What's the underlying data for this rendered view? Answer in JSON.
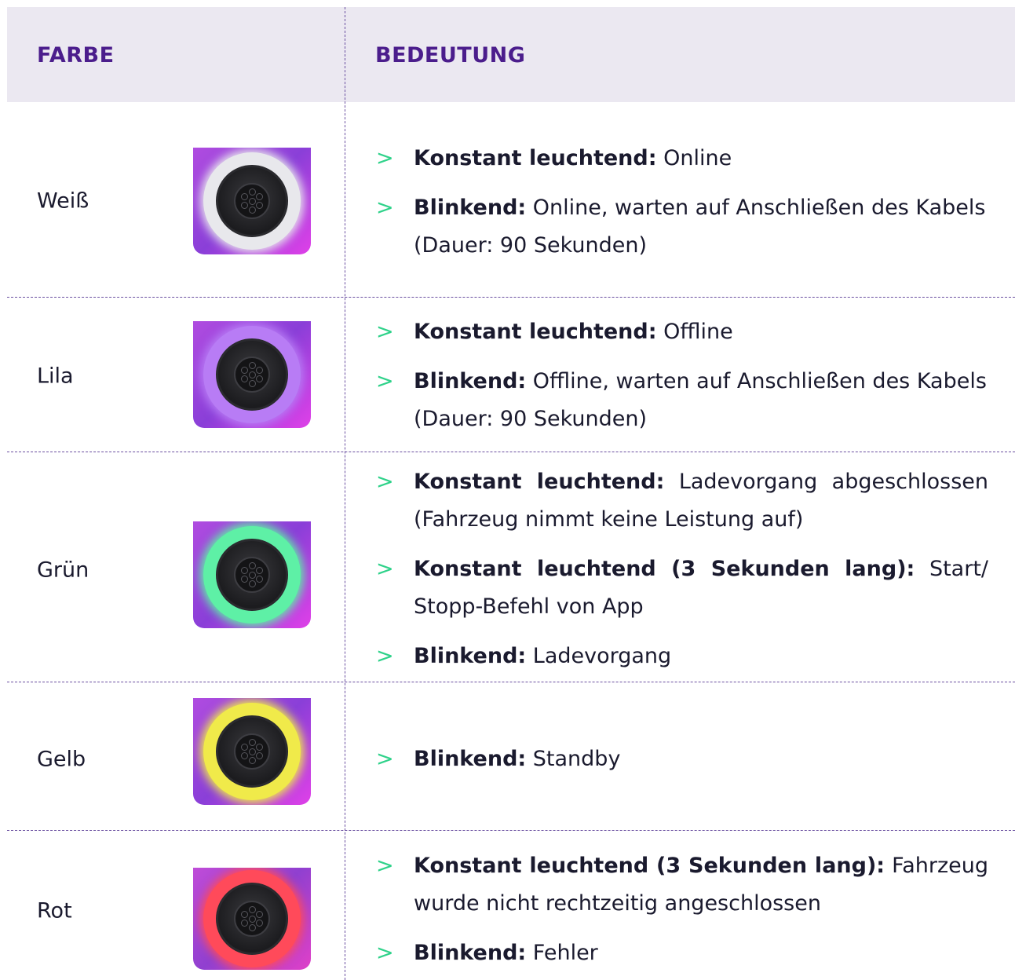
{
  "header": {
    "col1": "FARBE",
    "col2": "BEDEUTUNG"
  },
  "rows": [
    {
      "color": "Weiß",
      "ring_color": "#e8e8ec",
      "bullets": [
        {
          "bold": "Konstant leuchtend:",
          "text": " Online"
        },
        {
          "bold": "Blinkend:",
          "text": " Online, warten auf Anschließen des Kabels (Dauer: 90 Sekunden)"
        }
      ]
    },
    {
      "color": "Lila",
      "ring_color": "#b87cf5",
      "bullets": [
        {
          "bold": "Konstant leuchtend:",
          "text": " Offline"
        },
        {
          "bold": "Blinkend:",
          "text": " Offline, warten auf Anschließen des Kabels (Dauer: 90 Sekunden)"
        }
      ]
    },
    {
      "color": "Grün",
      "ring_color": "#5ef0a6",
      "bullets": [
        {
          "bold": "Konstant leuchtend:",
          "text": " Ladevorgang abgeschlossen (Fahrzeug nimmt keine Leistung auf)"
        },
        {
          "bold": "Konstant leuchtend (3 Sekunden lang):",
          "text": " Start/ Stopp-Befehl von App"
        },
        {
          "bold": "Blinkend:",
          "text": " Ladevorgang"
        }
      ]
    },
    {
      "color": "Gelb",
      "ring_color": "#f0ea4a",
      "bullets": [
        {
          "bold": "Blinkend:",
          "text": " Standby"
        }
      ]
    },
    {
      "color": "Rot",
      "ring_color": "#ff4a5a",
      "bullets": [
        {
          "bold": "Konstant leuchtend (3 Sekunden lang):",
          "text": " Fahrzeug wurde nicht rechtzeitig angeschlossen"
        },
        {
          "bold": "Blinkend:",
          "text": " Fehler"
        }
      ]
    }
  ],
  "colors": {
    "header_bg": "#ebe8f1",
    "header_text": "#4b1d8c",
    "arrow": "#2fd28a",
    "divider": "#6a4fa0"
  }
}
